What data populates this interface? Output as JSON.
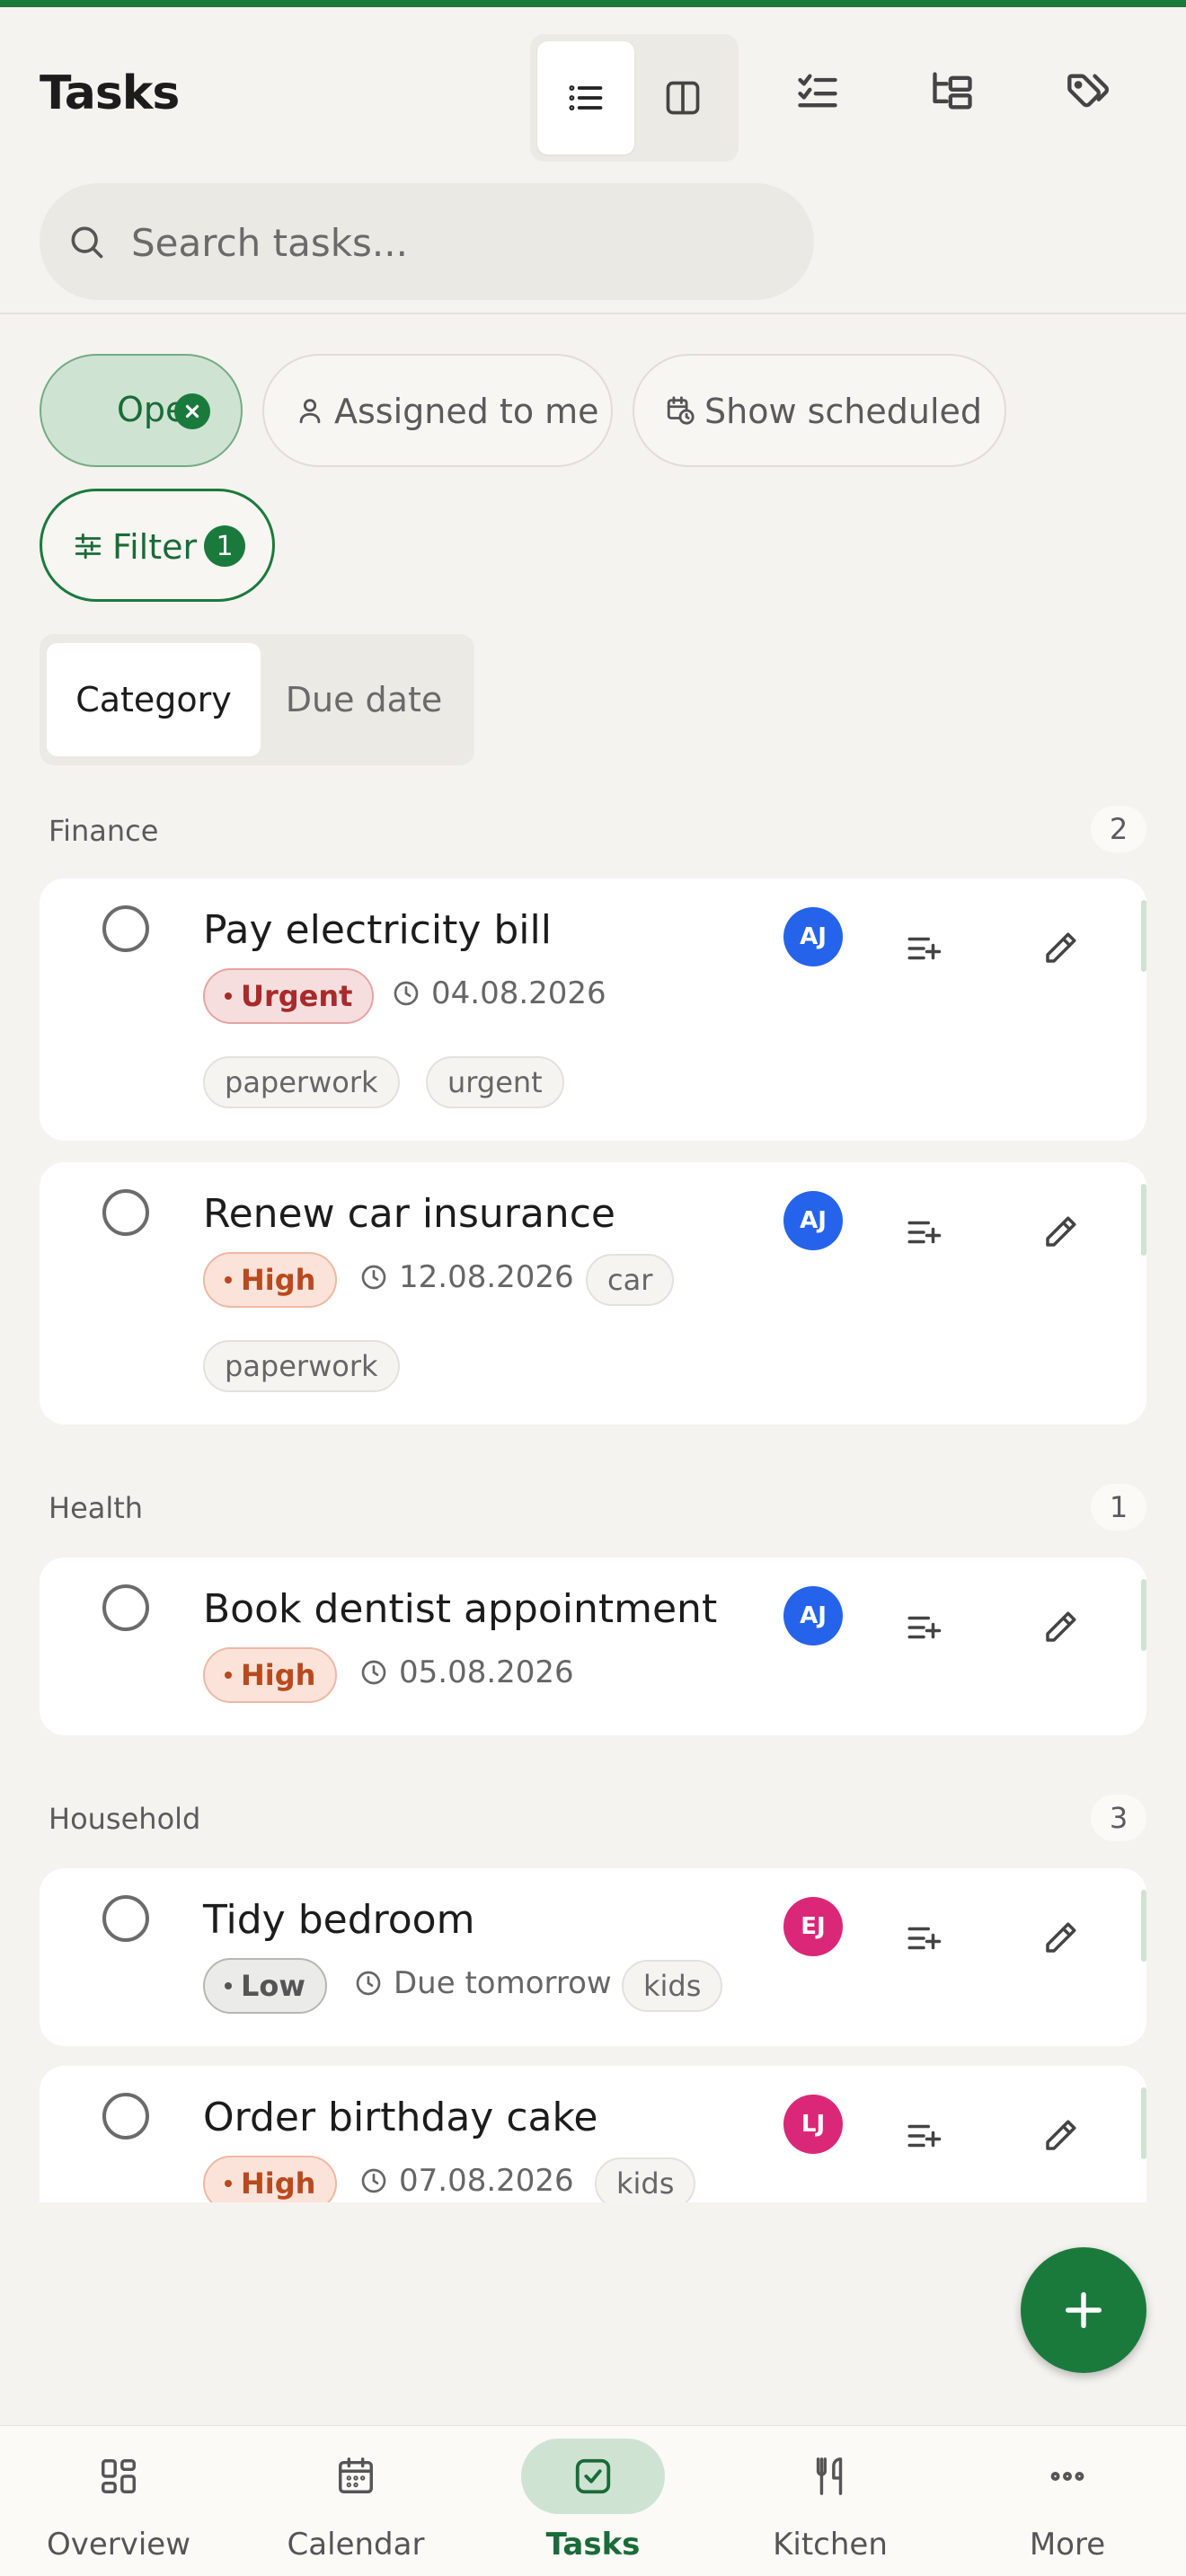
{
  "header": {
    "title": "Tasks",
    "search_placeholder": "Search tasks..."
  },
  "filters": {
    "open_label": "Open",
    "assigned_label": "Assigned to me",
    "scheduled_label": "Show scheduled",
    "filter_label": "Filter",
    "filter_count": "1"
  },
  "grouping": {
    "options": [
      "Category",
      "Due date"
    ],
    "selected": "Category"
  },
  "groups": [
    {
      "name": "Finance",
      "count": "2",
      "tasks": [
        {
          "title": "Pay electricity bill",
          "priority": "Urgent",
          "due": "04.08.2026",
          "tags": [
            "paperwork",
            "urgent"
          ],
          "assignee": "AJ"
        },
        {
          "title": "Renew car insurance",
          "priority": "High",
          "due": "12.08.2026",
          "tags": [
            "car",
            "paperwork"
          ],
          "assignee": "AJ"
        }
      ]
    },
    {
      "name": "Health",
      "count": "1",
      "tasks": [
        {
          "title": "Book dentist appointment",
          "priority": "High",
          "due": "05.08.2026",
          "tags": [],
          "assignee": "AJ"
        }
      ]
    },
    {
      "name": "Household",
      "count": "3",
      "tasks": [
        {
          "title": "Tidy bedroom",
          "priority": "Low",
          "due": "Due tomorrow",
          "tags": [
            "kids"
          ],
          "assignee": "EJ"
        },
        {
          "title": "Order birthday cake",
          "priority": "High",
          "due": "07.08.2026",
          "tags": [
            "kids"
          ],
          "assignee": "LJ"
        }
      ]
    }
  ],
  "bottom_nav": [
    {
      "label": "Overview",
      "icon": "grid-icon"
    },
    {
      "label": "Calendar",
      "icon": "calendar-icon"
    },
    {
      "label": "Tasks",
      "icon": "check-square-icon",
      "active": true
    },
    {
      "label": "Kitchen",
      "icon": "utensils-icon"
    },
    {
      "label": "More",
      "icon": "more-dots-icon"
    }
  ],
  "colors": {
    "accent": "#1a7a3c",
    "avatar_aj": "#2563eb",
    "avatar_ej": "#db2777",
    "avatar_lj": "#db2777",
    "urgent": "#a82a2a",
    "high": "#b94a1e"
  }
}
